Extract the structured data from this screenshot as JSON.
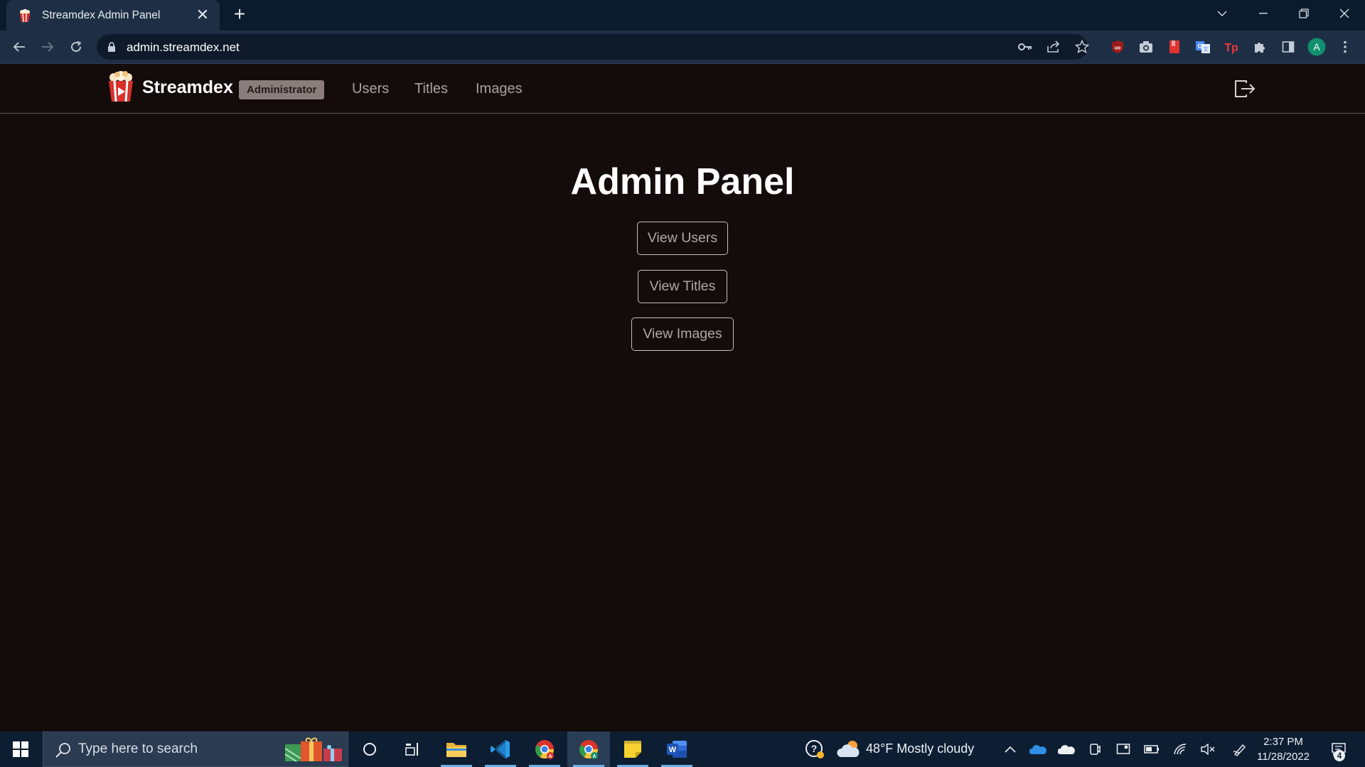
{
  "browser": {
    "tab_title": "Streamdex Admin Panel",
    "tab_close": "✕",
    "new_tab": "+",
    "url": "admin.streamdex.net",
    "profile_initial": "A"
  },
  "navbar": {
    "brand_name": "Streamdex",
    "badge": "Administrator",
    "links": [
      "Users",
      "Titles",
      "Images"
    ]
  },
  "main": {
    "title": "Admin Panel",
    "buttons": [
      "View Users",
      "View Titles",
      "View Images"
    ]
  },
  "taskbar": {
    "search_placeholder": "Type here to search",
    "weather": "48°F  Mostly cloudy",
    "time": "2:37 PM",
    "date": "11/28/2022",
    "notification_count": "4"
  }
}
